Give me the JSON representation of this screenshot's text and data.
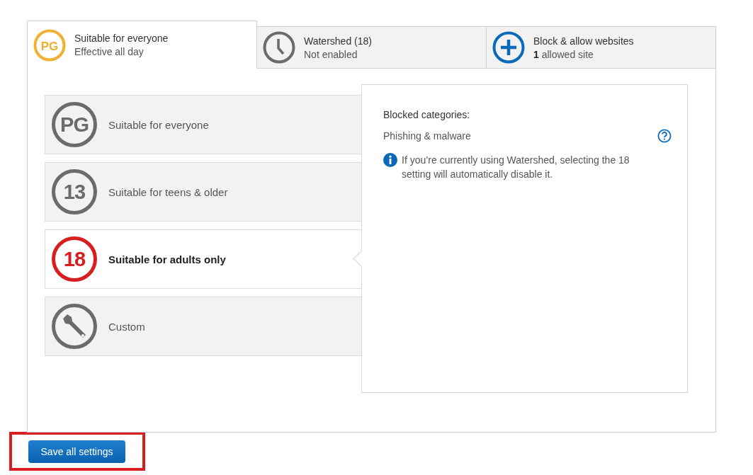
{
  "tabs": [
    {
      "kind": "badge",
      "badge": "PG",
      "title": "Suitable for everyone",
      "subtitle": "Effective all day",
      "selected": true
    },
    {
      "kind": "clock",
      "title": "Watershed (18)",
      "subtitle": "Not enabled",
      "selected": false
    },
    {
      "kind": "plus",
      "title": "Block & allow websites",
      "subtitle": "**1** allowed site",
      "selected": false
    }
  ],
  "options": [
    {
      "kind": "badge",
      "badge": "PG",
      "label": "Suitable for everyone",
      "selected": false
    },
    {
      "kind": "badge",
      "badge": "13",
      "label": "Suitable for teens & older",
      "selected": false
    },
    {
      "kind": "badge",
      "badge": "18",
      "label": "Suitable for adults only",
      "selected": true
    },
    {
      "kind": "wrench",
      "label": "Custom",
      "selected": false
    }
  ],
  "details": {
    "heading": "Blocked categories:",
    "categories": [
      "Phishing & malware"
    ],
    "note": "If you’re currently using Watershed, selecting the 18 setting will automatically disable it."
  },
  "save_button": {
    "label": "Save all settings",
    "highlighted": true
  }
}
